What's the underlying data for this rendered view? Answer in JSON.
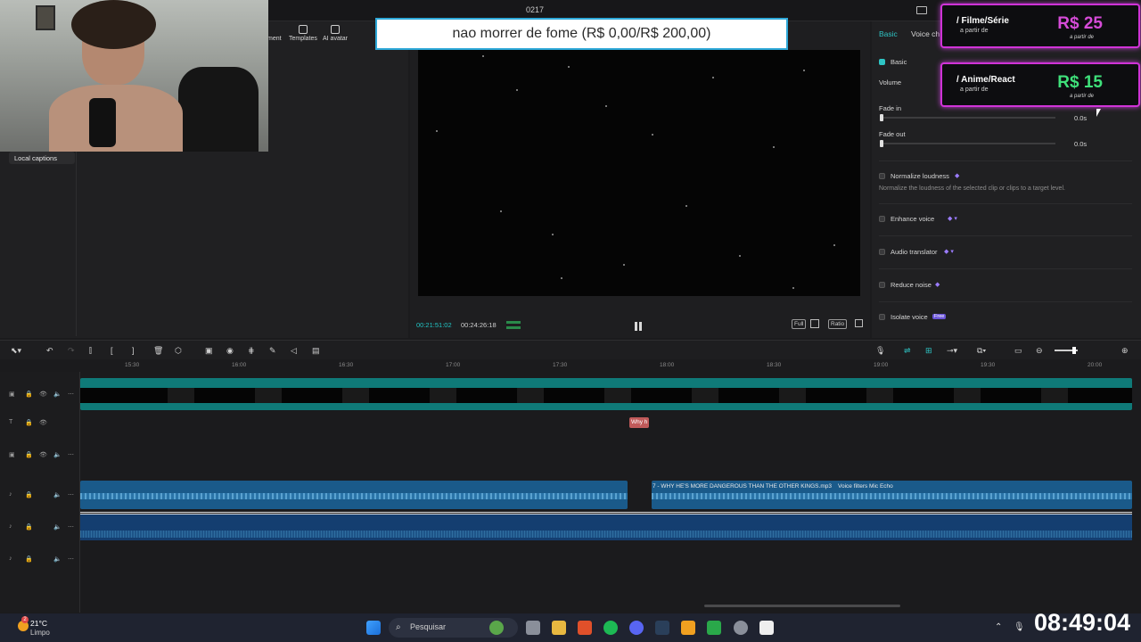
{
  "window": {
    "title": "0217"
  },
  "toolstrip": {
    "items": [
      "ment",
      "Templates",
      "AI avatar"
    ]
  },
  "sidebar": {
    "local_captions": "Local captions"
  },
  "overlay": {
    "goal_text": "nao morrer de fome (R$ 0,00/R$ 200,00)"
  },
  "player": {
    "current_time": "00:21:51:02",
    "total_time": "00:24:26:18",
    "buttons": [
      "Full",
      "Ratio"
    ]
  },
  "right_panel": {
    "tabs": [
      "Basic",
      "Voice ch"
    ],
    "basic_section": "Basic",
    "volume_label": "Volume",
    "fade_in_label": "Fade in",
    "fade_in_value": "0.0s",
    "fade_out_label": "Fade out",
    "fade_out_value": "0.0s",
    "normalize_label": "Normalize loudness",
    "normalize_desc": "Normalize the loudness of the selected clip or clips to a target level.",
    "enhance_label": "Enhance voice",
    "translator_label": "Audio translator",
    "reduce_noise_label": "Reduce noise",
    "isolate_label": "Isolate voice",
    "free_badge": "Free"
  },
  "price_cards": [
    {
      "name": "/ Filme/Série",
      "from": "a partir de",
      "price": "R$ 25",
      "from2": "a partir de",
      "color": "#d64bd8"
    },
    {
      "name": "/ Anime/React",
      "from": "a partir de",
      "price": "R$ 15",
      "from2": "a partir de",
      "color": "#3fe07a"
    }
  ],
  "timeline": {
    "ruler_ticks": [
      "15:30",
      "16:00",
      "16:30",
      "17:00",
      "17:30",
      "18:00",
      "18:30",
      "19:00",
      "19:30",
      "20:00"
    ],
    "text_clip": "Why h",
    "audio_clip_label": "7 - WHY HE'S MORE DANGEROUS THAN THE OTHER KINGS.mp3",
    "audio_clip_effect": "Voice filters Mic Echo"
  },
  "taskbar": {
    "temperature": "21°C",
    "weather": "Limpo",
    "search_placeholder": "Pesquisar",
    "clock": "08:49:04",
    "weather_badge": "2"
  }
}
